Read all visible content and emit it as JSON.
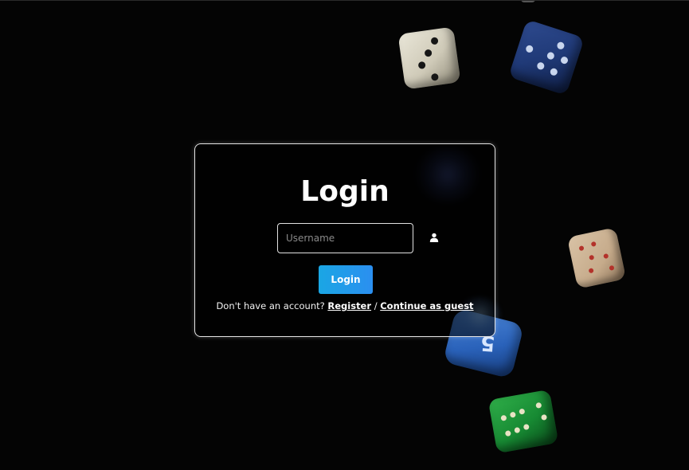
{
  "login": {
    "title": "Login",
    "username_placeholder": "Username",
    "username_value": "",
    "button_label": "Login",
    "footer_prefix": "Don't have an account?",
    "register_link": "Register",
    "separator": "/",
    "guest_link": "Continue as guest"
  },
  "decor": {
    "blue_die_face": "5"
  },
  "colors": {
    "background": "#040404",
    "button_start": "#1aa6e4",
    "button_end": "#2b8ff0",
    "card_border": "#e4e4e4"
  },
  "icons": {
    "username_icon": "user-icon"
  }
}
